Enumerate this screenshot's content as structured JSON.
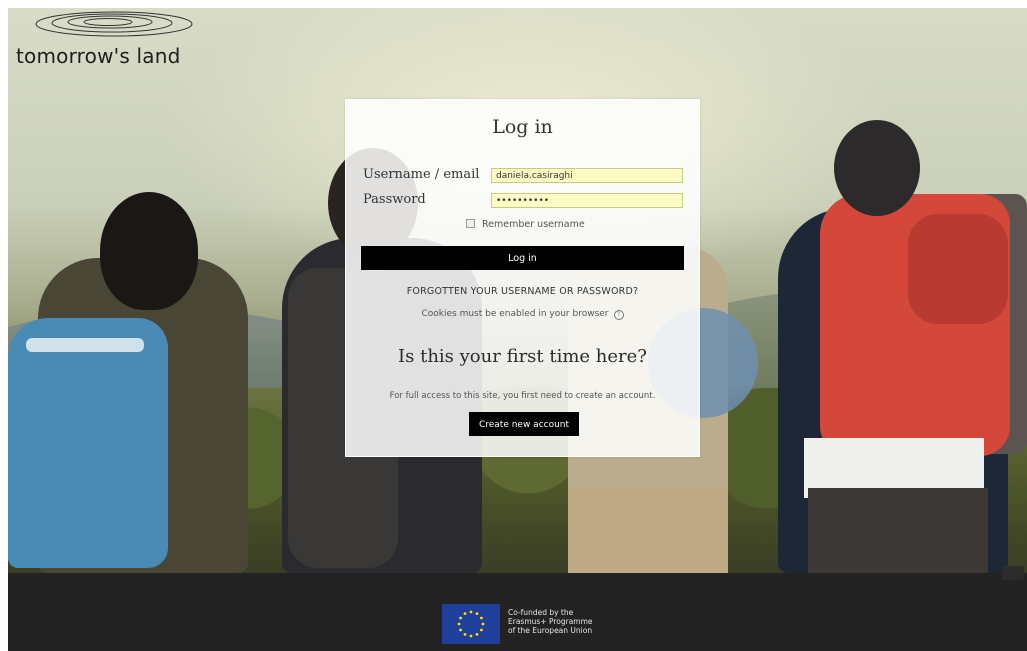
{
  "brand": {
    "logo_text": "tomorrow's land"
  },
  "login": {
    "title": "Log in",
    "username_label": "Username / email",
    "username_value": "daniela.casiraghi",
    "password_label": "Password",
    "password_value": "••••••••••",
    "remember_label": "Remember username",
    "remember_checked": false,
    "login_button": "Log in",
    "forgot_link": "FORGOTTEN YOUR USERNAME OR PASSWORD?",
    "cookies_notice": "Cookies must be enabled in your browser",
    "help_icon": "question-circle-icon"
  },
  "signup": {
    "heading": "Is this your first time here?",
    "description": "For full access to this site, you first need to create an account.",
    "create_button": "Create new account"
  },
  "footer": {
    "eu_line1": "Co-funded by the",
    "eu_line2": "Erasmus+ Programme",
    "eu_line3": "of the European Union",
    "eu_flag_icon": "eu-flag-icon",
    "eu_blue": "#1f3f9b",
    "eu_star_color": "#ffdd00"
  },
  "colors": {
    "button_bg": "#000000",
    "input_bg": "#fbfbc4",
    "footer_bg": "#222222"
  }
}
